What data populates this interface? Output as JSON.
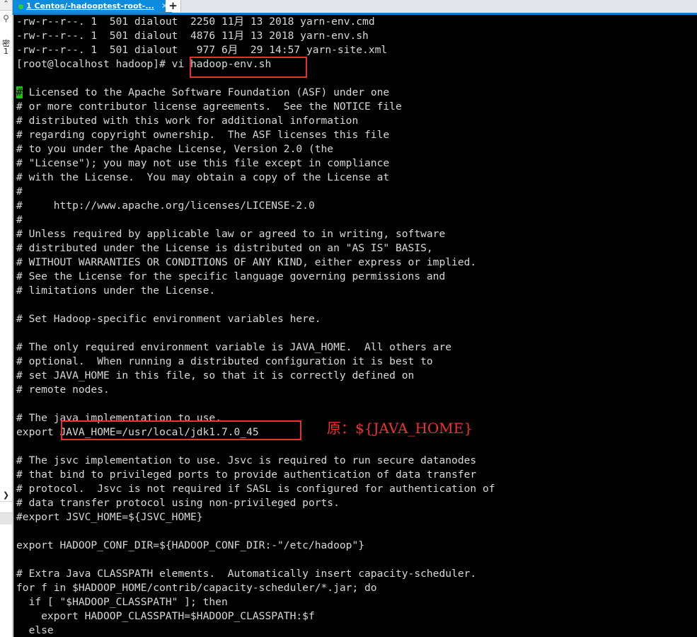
{
  "window": {
    "tabbar": {
      "active_tab": {
        "label": "1 Centos/-hadooptest-root-...",
        "status_dot": "connected-green",
        "close_glyph": "✕"
      },
      "new_tab_glyph": "+"
    },
    "sidebar": {
      "collapse_glyph": "⌃",
      "search_glyph": "⚲",
      "vertical_text": [
        "密",
        "1"
      ],
      "expand_glyph": "❯"
    }
  },
  "terminal": {
    "prompt": "[root@localhost hadoop]#",
    "command": "vi hadoop-env.sh",
    "listing": [
      "-rw-r--r--. 1  501 dialout  2250 11月 13 2018 yarn-env.cmd",
      "-rw-r--r--. 1  501 dialout  4876 11月 13 2018 yarn-env.sh",
      "-rw-r--r--. 1  501 dialout   977 6月  29 14:57 yarn-site.xml"
    ],
    "cursor_char": "#",
    "lines": [
      "-rw-r--r--. 1  501 dialout  2250 11月 13 2018 yarn-env.cmd",
      "-rw-r--r--. 1  501 dialout  4876 11月 13 2018 yarn-env.sh",
      "-rw-r--r--. 1  501 dialout   977 6月  29 14:57 yarn-site.xml",
      "[root@localhost hadoop]# vi hadoop-env.sh",
      "",
      "# Licensed to the Apache Software Foundation (ASF) under one",
      "# or more contributor license agreements.  See the NOTICE file",
      "# distributed with this work for additional information",
      "# regarding copyright ownership.  The ASF licenses this file",
      "# to you under the Apache License, Version 2.0 (the",
      "# \"License\"); you may not use this file except in compliance",
      "# with the License.  You may obtain a copy of the License at",
      "#",
      "#     http://www.apache.org/licenses/LICENSE-2.0",
      "#",
      "# Unless required by applicable law or agreed to in writing, software",
      "# distributed under the License is distributed on an \"AS IS\" BASIS,",
      "# WITHOUT WARRANTIES OR CONDITIONS OF ANY KIND, either express or implied.",
      "# See the License for the specific language governing permissions and",
      "# limitations under the License.",
      "",
      "# Set Hadoop-specific environment variables here.",
      "",
      "# The only required environment variable is JAVA_HOME.  All others are",
      "# optional.  When running a distributed configuration it is best to",
      "# set JAVA_HOME in this file, so that it is correctly defined on",
      "# remote nodes.",
      "",
      "# The java implementation to use.",
      "export JAVA_HOME=/usr/local/jdk1.7.0_45",
      "",
      "# The jsvc implementation to use. Jsvc is required to run secure datanodes",
      "# that bind to privileged ports to provide authentication of data transfer",
      "# protocol.  Jsvc is not required if SASL is configured for authentication of",
      "# data transfer protocol using non-privileged ports.",
      "#export JSVC_HOME=${JSVC_HOME}",
      "",
      "export HADOOP_CONF_DIR=${HADOOP_CONF_DIR:-\"/etc/hadoop\"}",
      "",
      "# Extra Java CLASSPATH elements.  Automatically insert capacity-scheduler.",
      "for f in $HADOOP_HOME/contrib/capacity-scheduler/*.jar; do",
      "  if [ \"$HADOOP_CLASSPATH\" ]; then",
      "    export HADOOP_CLASSPATH=$HADOOP_CLASSPATH:$f",
      "  else"
    ]
  },
  "annotations": {
    "highlight_command": "vi hadoop-env.sh",
    "highlight_java_home": "JAVA_HOME=/usr/local/jdk1.7.0_45",
    "note_original_value": "原：${JAVA_HOME}",
    "box_color": "#e8312f",
    "note_color": "#f0312f"
  }
}
